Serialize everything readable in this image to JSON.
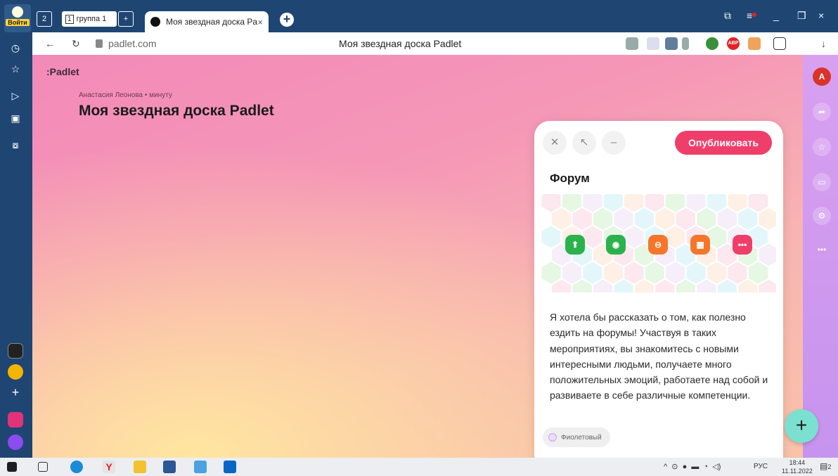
{
  "browser": {
    "login_label": "Войти",
    "tab_group_count": "2",
    "tab_group_num": "1",
    "tab_group_name": "группа 1",
    "active_tab_title": "Моя звездная доска Pa",
    "tab_close": "×",
    "new_tab": "+",
    "address_url": "padlet.com",
    "address_title": "Моя звездная доска Padlet",
    "back": "←",
    "reload": "↻",
    "download": "↓",
    "window_minimize": "_",
    "window_restore": "❐",
    "window_close": "×",
    "ext_badge": "ABP"
  },
  "board": {
    "logo": ":Padlet",
    "meta": "Анастасия Леонова • минуту",
    "title": "Моя звездная доска Padlet"
  },
  "composer": {
    "close_icon": "✕",
    "expand_icon": "↖",
    "minimize_icon": "–",
    "publish_label": "Опубликовать",
    "subject": "Форум",
    "body": "Я хотела бы рассказать о том, как полезно ездить на форумы! Участвуя в таких мероприятиях, вы знакомитесь с новыми интересными людьми, получаете много положительных эмоций, работаете над собой и развиваете в себе различные компетенции.",
    "color_label": "Фиолетовый",
    "attachments": [
      {
        "icon": "upload-icon",
        "color": "#2bb24c"
      },
      {
        "icon": "camera-icon",
        "color": "#2bb24c"
      },
      {
        "icon": "link-icon",
        "color": "#f5762a"
      },
      {
        "icon": "image-search-icon",
        "color": "#f5762a"
      },
      {
        "icon": "more-icon",
        "color": "#ef3e6a",
        "glyph": "•••"
      }
    ]
  },
  "right_strip": {
    "avatar_letter": "A",
    "more": "•••"
  },
  "fab_label": "+",
  "taskbar": {
    "lang": "РУС",
    "time": "18:44",
    "date": "11.11.2022",
    "notif_count": "2"
  },
  "colors": {
    "publish": "#ef3e6a",
    "fab": "#7be0d0",
    "browser_chrome": "#1f4573"
  }
}
